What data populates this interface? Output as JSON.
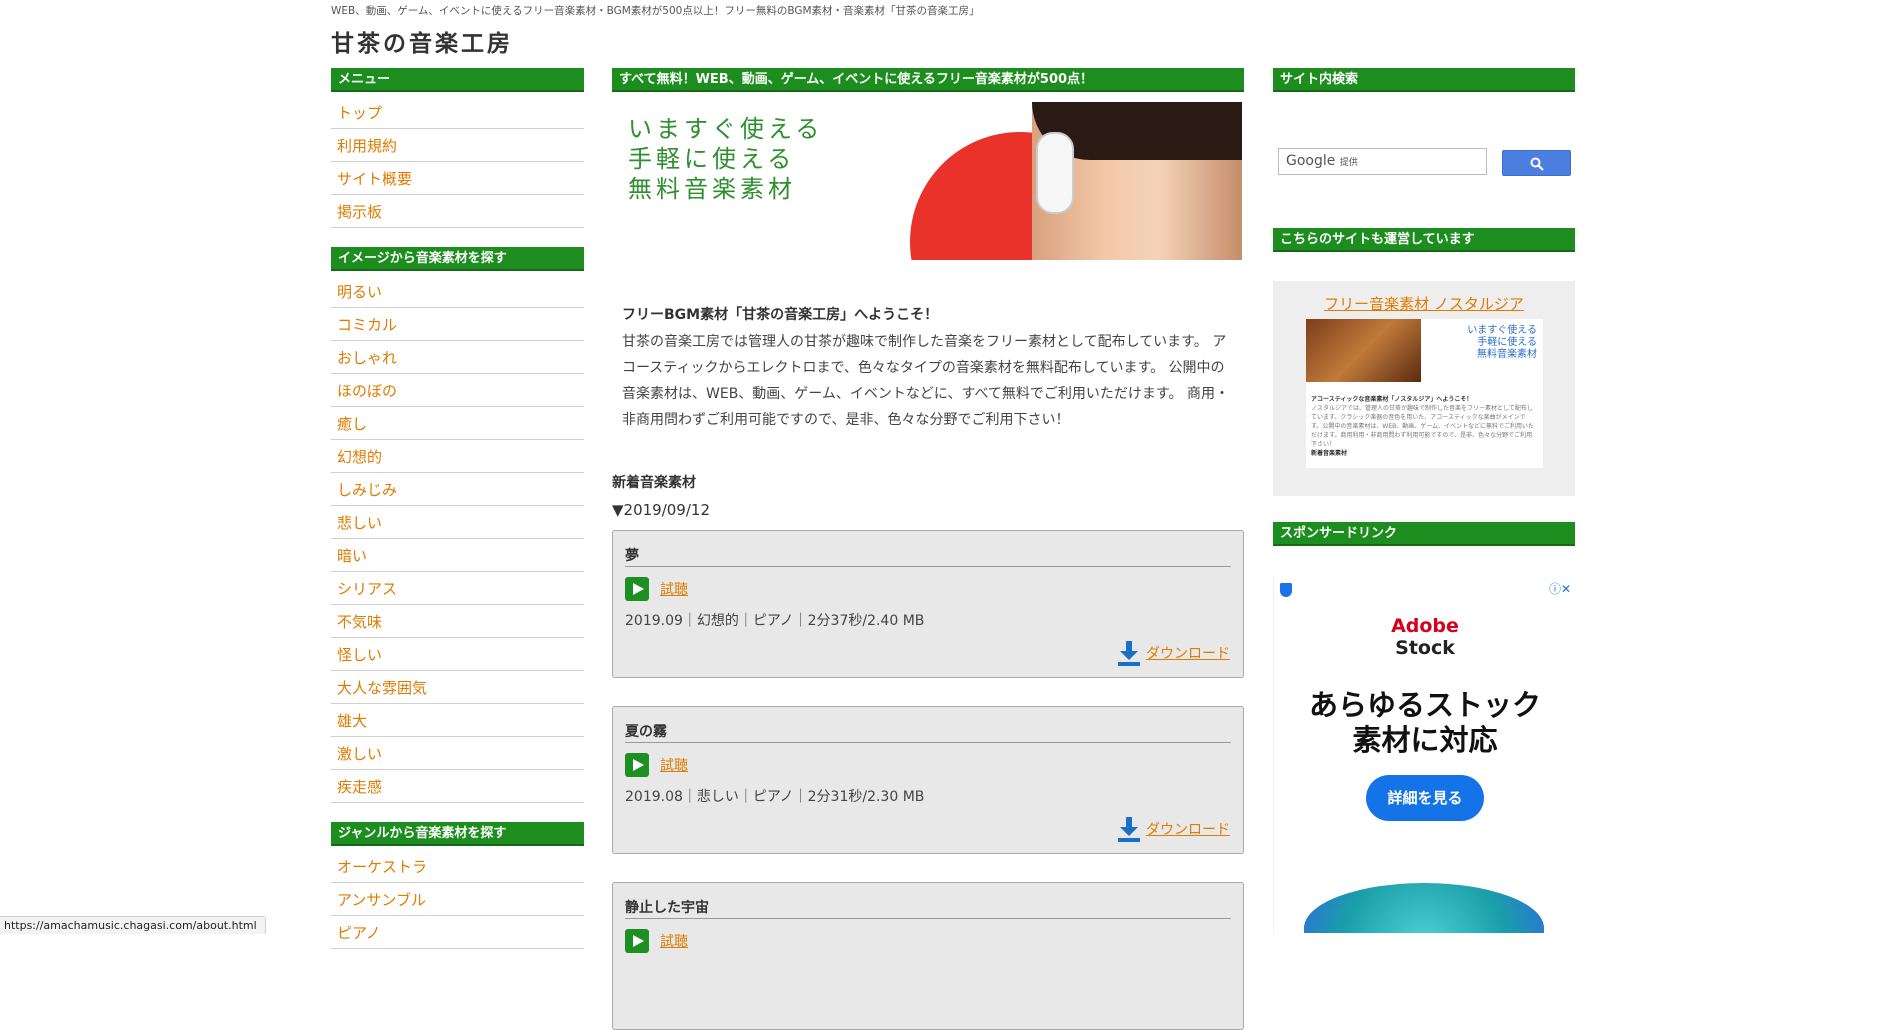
{
  "header": {
    "tagline": "WEB、動画、ゲーム、イベントに使えるフリー音楽素材・BGM素材が500点以上！フリー無料のBGM素材・音楽素材「甘茶の音楽工房」",
    "site_title": "甘茶の音楽工房"
  },
  "left": {
    "menu": {
      "heading": "メニュー",
      "items": [
        "トップ",
        "利用規約",
        "サイト概要",
        "掲示板"
      ]
    },
    "by_image": {
      "heading": "イメージから音楽素材を探す",
      "items": [
        "明るい",
        "コミカル",
        "おしゃれ",
        "ほのぼの",
        "癒し",
        "幻想的",
        "しみじみ",
        "悲しい",
        "暗い",
        "シリアス",
        "不気味",
        "怪しい",
        "大人な雰囲気",
        "雄大",
        "激しい",
        "疾走感"
      ]
    },
    "by_genre": {
      "heading": "ジャンルから音楽素材を探す",
      "items": [
        "オーケストラ",
        "アンサンブル",
        "ピアノ"
      ]
    }
  },
  "main": {
    "heading": "すべて無料！WEB、動画、ゲーム、イベントに使えるフリー音楽素材が500点！",
    "hero_lines": [
      "いますぐ使える",
      "手軽に使える",
      "無料音楽素材"
    ],
    "welcome_title": "フリーBGM素材「甘茶の音楽工房」へようこそ！",
    "welcome_lines": [
      "甘茶の音楽工房では管理人の甘茶が趣味で制作した音楽をフリー素材として配布しています。 ア",
      "コースティックからエレクトロまで、色々なタイプの音楽素材を無料配布しています。 公開中の",
      "音楽素材は、WEB、動画、ゲーム、イベントなどに、すべて無料でご利用いただけます。 商用・",
      "非商用問わずご利用可能ですので、是非、色々な分野でご利用下さい！"
    ],
    "new_title": "新着音楽素材",
    "date": "▼2019/09/12",
    "listen_label": "試聴",
    "download_label": "ダウンロード",
    "tracks": [
      {
        "title": "夢",
        "meta": "2019.09｜幻想的｜ピアノ｜2分37秒/2.40 MB"
      },
      {
        "title": "夏の霧",
        "meta": "2019.08｜悲しい｜ピアノ｜2分31秒/2.30 MB"
      },
      {
        "title": "静止した宇宙",
        "meta": ""
      }
    ]
  },
  "right": {
    "search_heading": "サイト内検索",
    "search_brand": "Google",
    "search_brand_suffix": "提供",
    "sister_heading": "こちらのサイトも運営しています",
    "sister_link": "フリー音楽素材 ノスタルジア",
    "sister_thumb_lines": [
      "いますぐ使える",
      "手軽に使える",
      "無料音楽素材"
    ],
    "sister_thumb_welcome": "アコースティックな音楽素材「ノスタルジア」へようこそ！",
    "sister_thumb_body": "ノスタルジアでは、管理人の甘茶が趣味で制作した音楽をフリー素材として配布しています。クラシック楽器の音色を用いた、アコースティックな楽曲がメインです。公開中の音楽素材は、WEB、動画、ゲーム、イベントなどに無料でご利用いただけます。商用利用・非商用問わず利用可能ですので、是非、色々な分野でご利用下さい！",
    "sister_thumb_new": "新着音楽素材",
    "sponsor_heading": "スポンサードリンク",
    "ad": {
      "brand_top": "Adobe",
      "brand_bottom": "Stock",
      "headline_1": "あらゆるストック",
      "headline_2": "素材に対応",
      "cta": "詳細を見る",
      "info_glyph": "ⓘ✕"
    }
  },
  "status_url": "https://amachamusic.chagasi.com/about.html",
  "colors": {
    "heading_green": "#1d8d1f",
    "link_orange": "#e07b00",
    "ad_blue": "#1473e6"
  }
}
